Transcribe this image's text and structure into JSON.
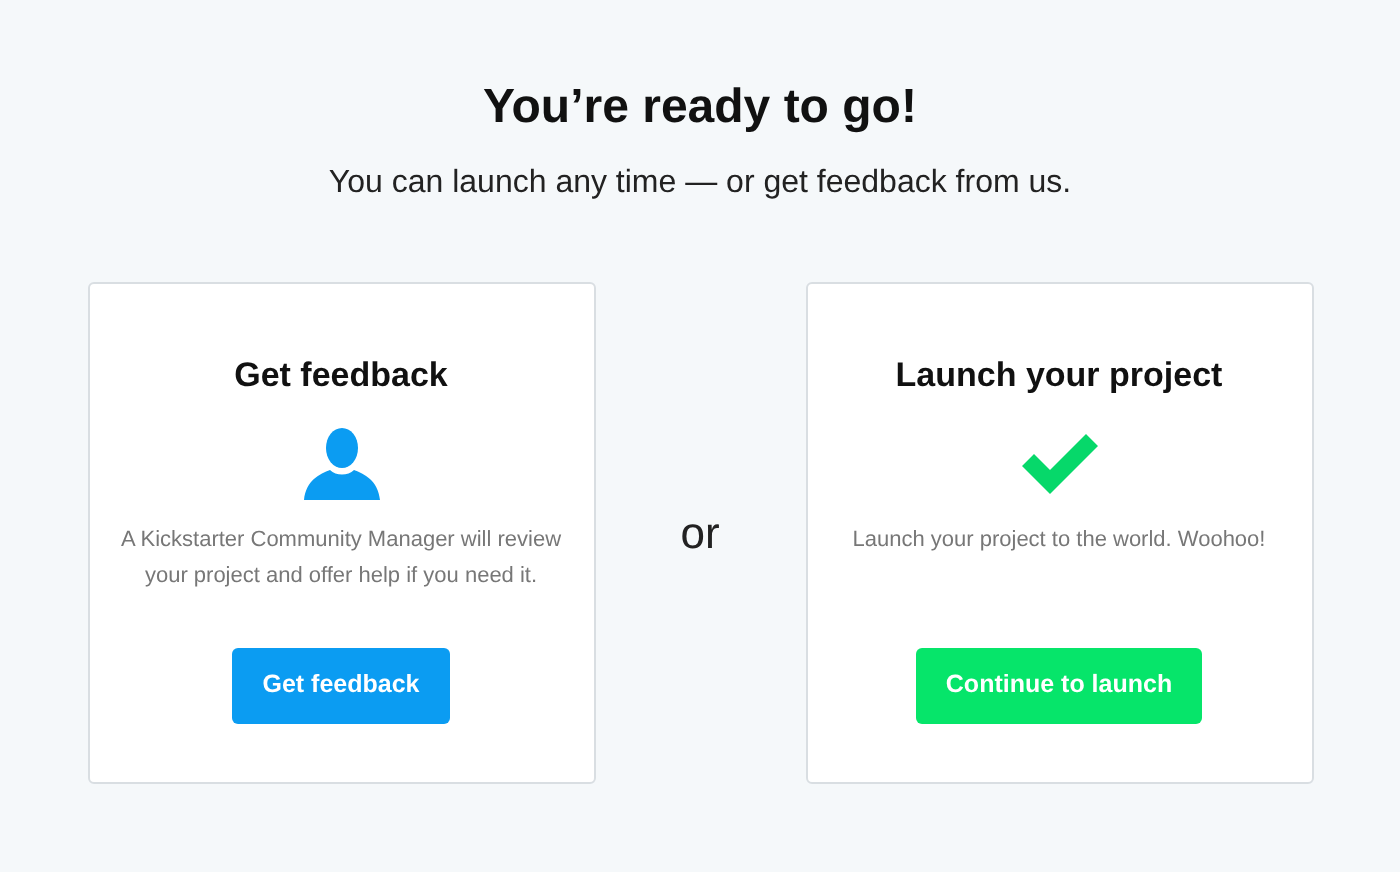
{
  "heading": "You’re ready to go!",
  "subheading": "You can launch any time — or get feedback from us.",
  "cards": [
    {
      "kind": "feedback",
      "title": "Get feedback",
      "description": "A Kickstarter Community Manager will review your project and offer help if you need it.",
      "button": "Get feedback"
    },
    {
      "kind": "launch",
      "title": "Launch your project",
      "description": "Launch your project to the world. Woohoo!",
      "button": "Continue to launch"
    }
  ],
  "separator": "or"
}
